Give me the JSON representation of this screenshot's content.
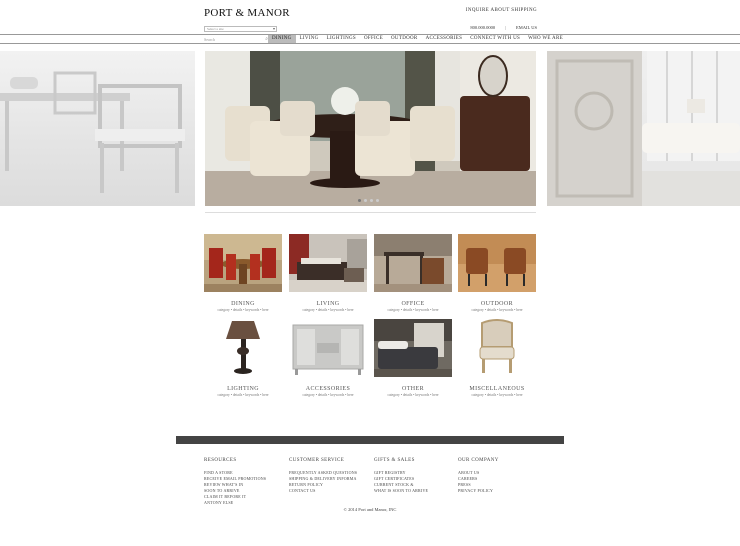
{
  "header": {
    "logo": "PORT & MANOR",
    "inquire": "INQUIRE ABOUT SHIPPING",
    "phone": "800.000.0000",
    "separator": "|",
    "email": "EMAIL US",
    "select_placeholder": "Select a site",
    "search_placeholder": "Search"
  },
  "nav": {
    "items": [
      {
        "label": "DINING",
        "active": true
      },
      {
        "label": "LIVING"
      },
      {
        "label": "LIGHTINGS"
      },
      {
        "label": "OFFICE"
      },
      {
        "label": "OUTDOOR"
      },
      {
        "label": "ACCESSORIES"
      },
      {
        "label": "CONNECT WITH US"
      },
      {
        "label": "WHO WE ARE"
      }
    ]
  },
  "slider": {
    "total_slides": 4,
    "active_slide": 1
  },
  "categories": [
    {
      "title": "DINING",
      "sub": "category • details • keywords • here"
    },
    {
      "title": "LIVING",
      "sub": "category • details • keywords • here"
    },
    {
      "title": "OFFICE",
      "sub": "category • details • keywords • here"
    },
    {
      "title": "OUTDOOR",
      "sub": "category • details • keywords • here"
    },
    {
      "title": "LIGHTING",
      "sub": "category • details • keywords • here"
    },
    {
      "title": "ACCESSORIES",
      "sub": "category • details • keywords • here"
    },
    {
      "title": "OTHER",
      "sub": "category • details • keywords • here"
    },
    {
      "title": "MISCELLANEOUS",
      "sub": "category • details • keywords • here"
    }
  ],
  "footer": {
    "columns": [
      {
        "heading": "RESOURCES",
        "links": [
          "FIND A STORE",
          "RECEIVE EMAIL PROMOTIONS",
          "REVIEW WHAT'S IN",
          "SOON TO ARRIVE",
          "CLAIM IT BEFORE IT",
          "ANTONY ELSE"
        ]
      },
      {
        "heading": "CUSTOMER SERVICE",
        "links": [
          "FREQUENTLY ASKED QUESTIONS",
          "SHIPPING & DELIVERY INFORMA",
          "RETURN POLICY",
          "CONTACT US"
        ]
      },
      {
        "heading": "GIFTS & SALES",
        "links": [
          "GIFT REGISTRY",
          "GIFT CERTIFICATES",
          "CURRENT STOCK &",
          "WHAT IS SOON TO ARRIVE"
        ]
      },
      {
        "heading": "OUR COMPANY",
        "links": [
          "ABOUT US",
          "CAREERS",
          "PRESS",
          "PRIVACY POLICY"
        ]
      }
    ],
    "copyright": "© 2014 Port and Manor, INC"
  }
}
